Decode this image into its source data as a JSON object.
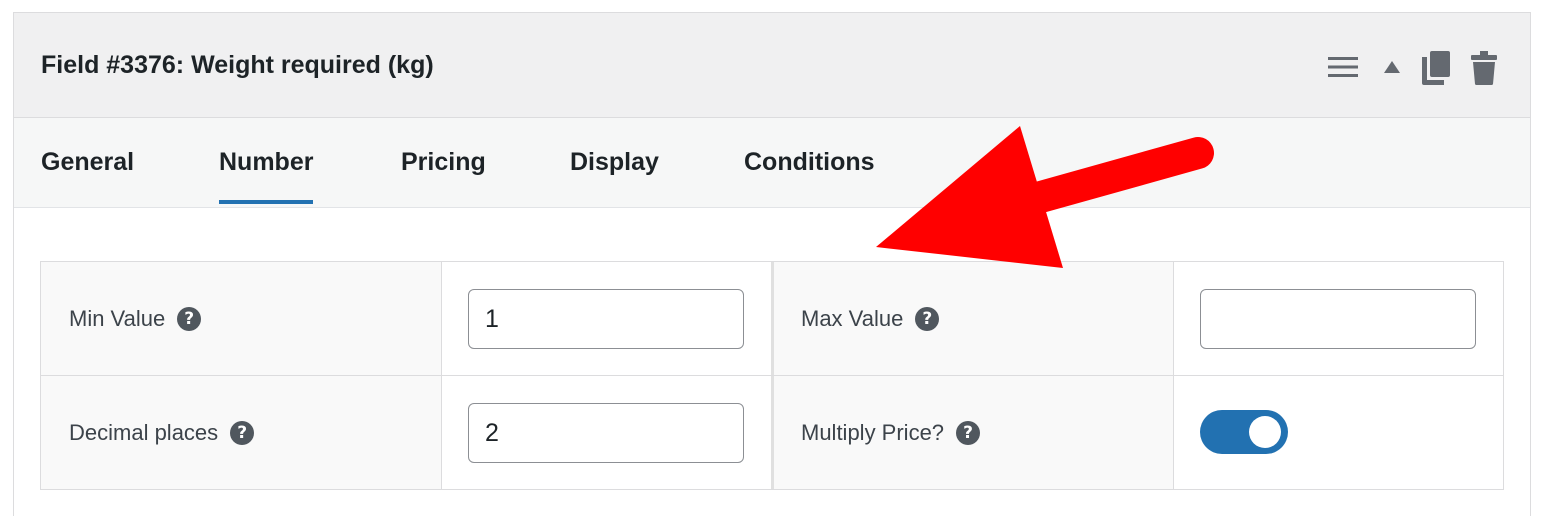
{
  "field": {
    "title": "Field #3376: Weight required (kg)",
    "actions": [
      {
        "name": "menu-icon"
      },
      {
        "name": "collapse-arrow-icon"
      },
      {
        "name": "duplicate-icon"
      },
      {
        "name": "trash-icon"
      }
    ]
  },
  "tabs": [
    {
      "label": "General",
      "active": false
    },
    {
      "label": "Number",
      "active": true
    },
    {
      "label": "Pricing",
      "active": false
    },
    {
      "label": "Display",
      "active": false
    },
    {
      "label": "Conditions",
      "active": false
    }
  ],
  "settings": {
    "min_value": {
      "label": "Min Value",
      "value": "1"
    },
    "max_value": {
      "label": "Max Value",
      "value": ""
    },
    "decimal_places": {
      "label": "Decimal places",
      "value": "2"
    },
    "multiply_price": {
      "label": "Multiply Price?",
      "enabled": true
    }
  },
  "help_glyph": "?",
  "colors": {
    "accent": "#2271b1",
    "annotation_arrow": "#ff0000",
    "header_bg": "#f0f0f1"
  }
}
